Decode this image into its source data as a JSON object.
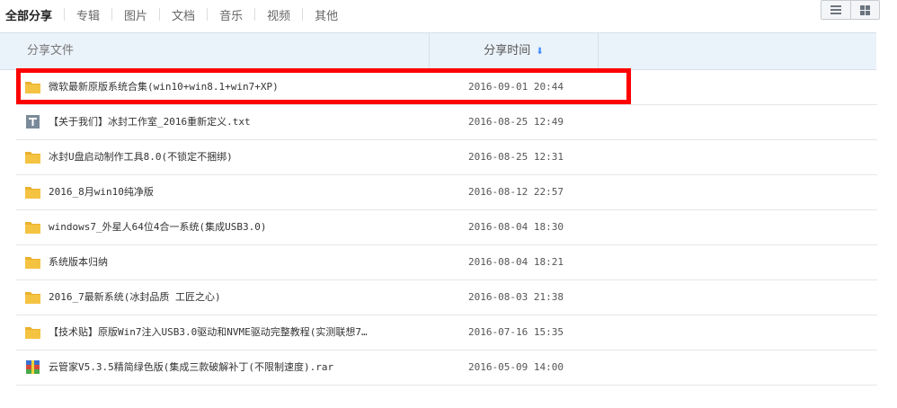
{
  "tabs": [
    {
      "label": "全部分享",
      "active": true
    },
    {
      "label": "专辑",
      "active": false
    },
    {
      "label": "图片",
      "active": false
    },
    {
      "label": "文档",
      "active": false
    },
    {
      "label": "音乐",
      "active": false
    },
    {
      "label": "视频",
      "active": false
    },
    {
      "label": "其他",
      "active": false
    }
  ],
  "view_toggle": {
    "list_icon": "list-view-icon",
    "grid_icon": "grid-view-icon"
  },
  "table": {
    "col_name": "分享文件",
    "col_time": "分享时间",
    "sort_icon": "sort-down-icon",
    "rows": [
      {
        "icon": "folder",
        "name": "微软最新原版系统合集(win10+win8.1+win7+XP)",
        "time": "2016-09-01 20:44"
      },
      {
        "icon": "txt",
        "name": "【关于我们】冰封工作室_2016重新定义.txt",
        "time": "2016-08-25 12:49"
      },
      {
        "icon": "folder",
        "name": "冰封U盘启动制作工具8.0(不锁定不捆绑)",
        "time": "2016-08-25 12:31"
      },
      {
        "icon": "folder",
        "name": "2016_8月win10纯净版",
        "time": "2016-08-12 22:57"
      },
      {
        "icon": "folder",
        "name": "windows7_外星人64位4合一系统(集成USB3.0)",
        "time": "2016-08-04 18:30"
      },
      {
        "icon": "folder",
        "name": "系统版本归纳",
        "time": "2016-08-04 18:21"
      },
      {
        "icon": "folder",
        "name": "2016_7最新系统(冰封品质 工匠之心)",
        "time": "2016-08-03 21:38"
      },
      {
        "icon": "folder",
        "name": "【技术贴】原版Win7注入USB3.0驱动和NVME驱动完整教程(实测联想7…",
        "time": "2016-07-16 15:35"
      },
      {
        "icon": "rar",
        "name": "云管家V5.3.5精简绿色版(集成三款破解补丁(不限制速度).rar",
        "time": "2016-05-09 14:00"
      }
    ]
  },
  "colors": {
    "highlight": "#ff0000",
    "header_bg": "#eaf2fa",
    "folder": "#f5c342",
    "sort_arrow": "#3b8cff"
  }
}
